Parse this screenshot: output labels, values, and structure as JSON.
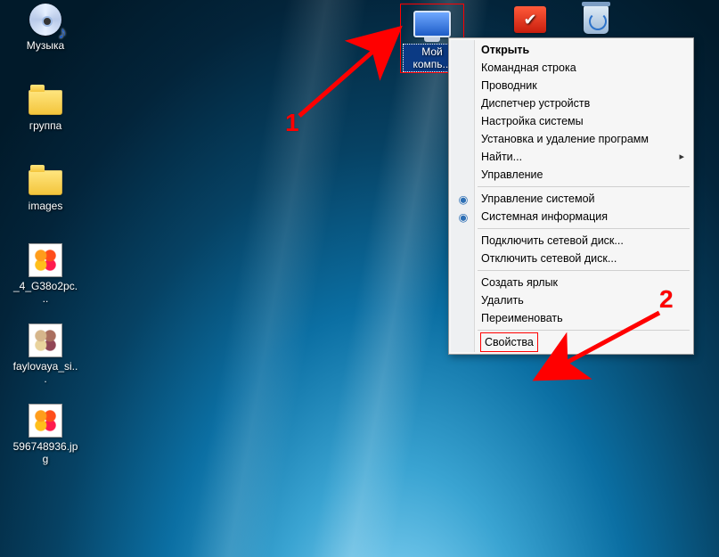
{
  "desktop": {
    "icons": {
      "music": "Музыка",
      "group": "группа",
      "images": "images",
      "file1": "_4_G38o2pc...",
      "file2": "faylovaya_si...",
      "file3": "596748936.jpg",
      "my_computer": "Мой компь...",
      "red_icon": "",
      "recycle_bin": "Корзина"
    }
  },
  "context_menu": {
    "items": [
      "Открыть",
      "Командная строка",
      "Проводник",
      "Диспетчер устройств",
      "Настройка системы",
      "Установка и удаление программ",
      "Найти...",
      "Управление",
      "Управление системой",
      "Системная информация",
      "Подключить сетевой диск...",
      "Отключить сетевой диск...",
      "Создать ярлык",
      "Удалить",
      "Переименовать",
      "Свойства"
    ]
  },
  "annotations": {
    "label1": "1",
    "label2": "2"
  }
}
